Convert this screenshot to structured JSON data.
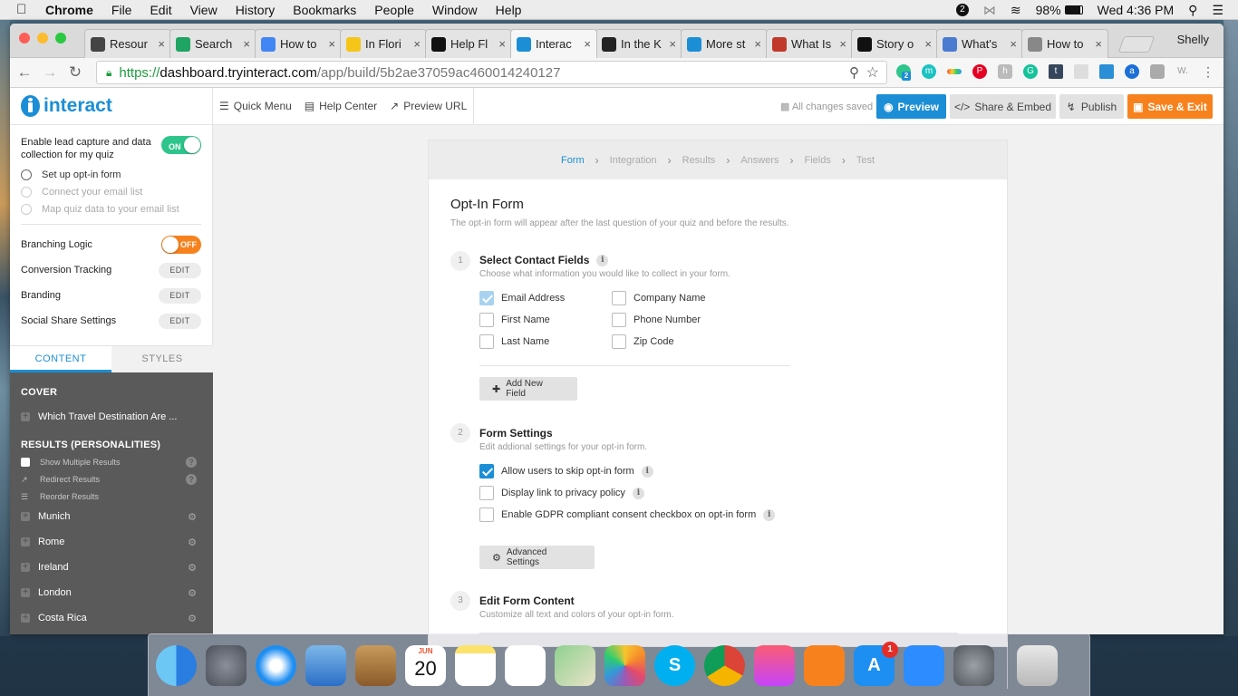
{
  "menubar": {
    "app": "Chrome",
    "items": [
      "File",
      "Edit",
      "View",
      "History",
      "Bookmarks",
      "People",
      "Window",
      "Help"
    ],
    "notif_count": "2",
    "battery": "98%",
    "clock": "Wed 4:36 PM"
  },
  "browser": {
    "tabs": [
      {
        "title": "Resour",
        "icon": "wordpress-icon",
        "color": "#444444"
      },
      {
        "title": "Search",
        "icon": "google-drive-icon",
        "color": "#1fa463"
      },
      {
        "title": "How to",
        "icon": "google-docs-icon",
        "color": "#4285f4"
      },
      {
        "title": "In Flori",
        "icon": "m-icon",
        "color": "#f5c518"
      },
      {
        "title": "Help Fl",
        "icon": "s-icon",
        "color": "#111111"
      },
      {
        "title": "Interac",
        "icon": "interact-icon",
        "color": "#1c8ed6",
        "active": true
      },
      {
        "title": "In the K",
        "icon": "h-icon",
        "color": "#222222"
      },
      {
        "title": "More st",
        "icon": "in-icon",
        "color": "#1c8ed6"
      },
      {
        "title": "What Is",
        "icon": "news-icon",
        "color": "#c0392b"
      },
      {
        "title": "Story o",
        "icon": "a-icon",
        "color": "#111111"
      },
      {
        "title": "What's",
        "icon": "pt-icon",
        "color": "#4a7bd0"
      },
      {
        "title": "How to",
        "icon": "book-icon",
        "color": "#888888"
      }
    ],
    "profile": "Shelly",
    "url_scheme": "https://",
    "url_host": "dashboard.tryinteract.com",
    "url_path": "/app/build/5b2ae37059ac460014240127",
    "ext_badge": "2"
  },
  "header": {
    "logo": "interact",
    "quick_menu": "Quick Menu",
    "help_center": "Help Center",
    "preview_url": "Preview URL",
    "saved_status": "All changes saved",
    "preview": "Preview",
    "share_embed": "Share & Embed",
    "publish": "Publish",
    "save_exit": "Save & Exit"
  },
  "sidebar": {
    "lead_capture_label": "Enable lead capture and data collection for my quiz",
    "lead_toggle": "ON",
    "lead_steps": [
      {
        "label": "Set up opt-in form",
        "enabled": true
      },
      {
        "label": "Connect your email list",
        "enabled": false
      },
      {
        "label": "Map quiz data to your email list",
        "enabled": false
      }
    ],
    "branching_label": "Branching Logic",
    "branching_toggle": "OFF",
    "settings": [
      {
        "label": "Conversion Tracking",
        "button": "EDIT"
      },
      {
        "label": "Branding",
        "button": "EDIT"
      },
      {
        "label": "Social Share Settings",
        "button": "EDIT"
      }
    ],
    "tabs": {
      "content": "CONTENT",
      "styles": "STYLES"
    },
    "cover_heading": "COVER",
    "cover_item": "Which Travel Destination Are ...",
    "results_heading": "RESULTS (PERSONALITIES)",
    "results_tools": [
      "Show Multiple Results",
      "Redirect Results",
      "Reorder Results"
    ],
    "results": [
      "Munich",
      "Rome",
      "Ireland",
      "London",
      "Costa Rica"
    ]
  },
  "wizard": {
    "steps": [
      "Form",
      "Integration",
      "Results",
      "Answers",
      "Fields",
      "Test"
    ],
    "active_step": "Form"
  },
  "form": {
    "title": "Opt-In Form",
    "subtitle": "The opt-in form will appear after the last question of your quiz and before the results.",
    "section1": {
      "num": "1",
      "title": "Select Contact Fields",
      "desc": "Choose what information you would like to collect in your form.",
      "fields": [
        {
          "label": "Email Address",
          "checked": true
        },
        {
          "label": "First Name",
          "checked": false
        },
        {
          "label": "Last Name",
          "checked": false
        },
        {
          "label": "Company Name",
          "checked": false
        },
        {
          "label": "Phone Number",
          "checked": false
        },
        {
          "label": "Zip Code",
          "checked": false
        }
      ],
      "add_button": "Add New Field"
    },
    "section2": {
      "num": "2",
      "title": "Form Settings",
      "desc": "Edit addional settings for your opt-in form.",
      "options": [
        {
          "label": "Allow users to skip opt-in form",
          "checked": true
        },
        {
          "label": "Display link to privacy policy",
          "checked": false
        },
        {
          "label": "Enable GDPR compliant consent checkbox on opt-in form",
          "checked": false
        }
      ],
      "advanced_button": "Advanced Settings"
    },
    "section3": {
      "num": "3",
      "title": "Edit Form Content",
      "desc": "Customize all text and colors of your opt-in form."
    }
  },
  "dock": {
    "calendar_month": "JUN",
    "calendar_day": "20",
    "appstore_badge": "1",
    "apps": [
      "finder-icon",
      "launchpad-icon",
      "safari-icon",
      "mail-icon",
      "contacts-icon",
      "calendar-icon",
      "notes-icon",
      "reminders-icon",
      "maps-icon",
      "photos-icon",
      "skype-icon",
      "chrome-icon",
      "itunes-icon",
      "ibooks-icon",
      "appstore-icon",
      "zoom-icon",
      "system-preferences-icon",
      "trash-icon"
    ]
  },
  "colors": {
    "brand": "#1c8ed6",
    "accent_orange": "#f7821d",
    "toggle_on": "#2ec58c",
    "sidebar_dark": "#5a5a5a"
  }
}
